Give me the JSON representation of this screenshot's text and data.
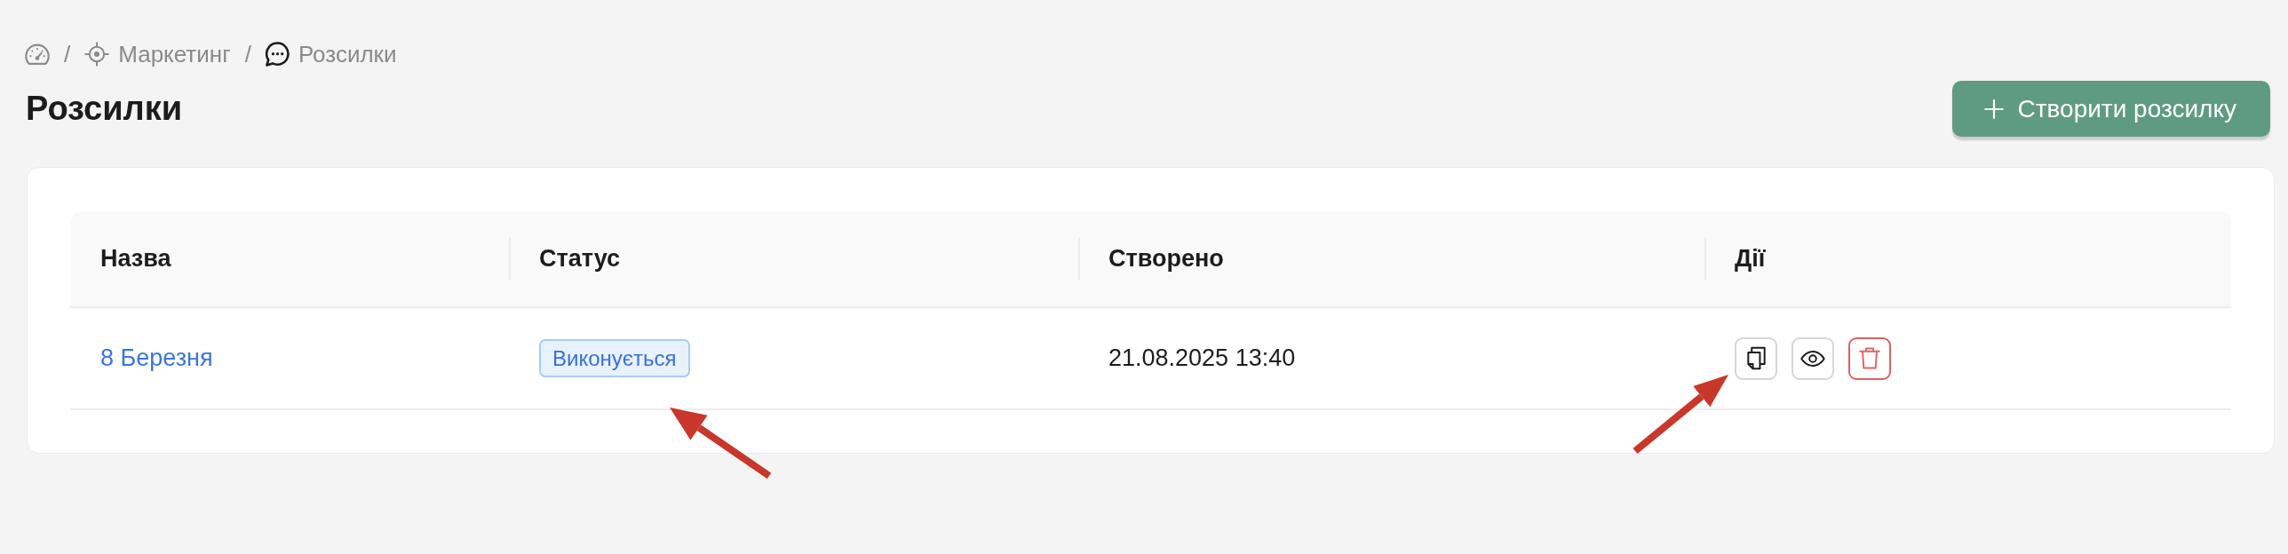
{
  "breadcrumb": [
    {
      "kind": "home"
    },
    {
      "kind": "section",
      "separator": "/",
      "label": "Маркетинг"
    },
    {
      "kind": "page",
      "separator": "/",
      "label": "Розсилки"
    }
  ],
  "title": "Розсилки",
  "create_button": {
    "label": "Створити розсилку"
  },
  "table": {
    "columns": [
      "Назва",
      "Статус",
      "Створено",
      "Дії"
    ],
    "rows": [
      {
        "name": "8 Березня",
        "status": {
          "label": "Виконується",
          "arrow": true
        },
        "created": "21.08.2025 13:40",
        "actions": [
          {
            "kind": "copy",
            "arrow": true
          },
          {
            "kind": "view",
            "arrow": false
          },
          {
            "kind": "delete",
            "arrow": false
          }
        ]
      }
    ]
  }
}
